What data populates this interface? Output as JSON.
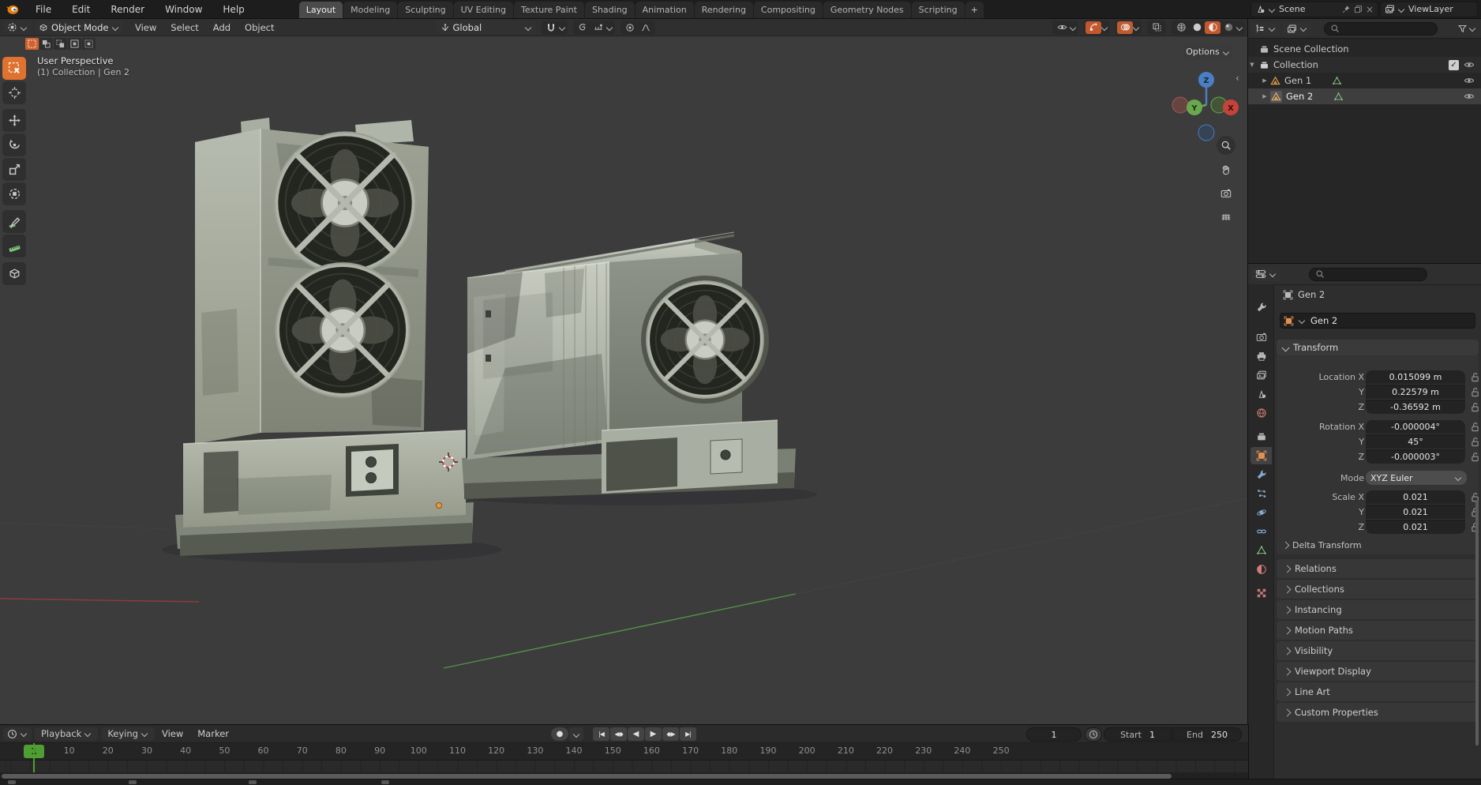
{
  "topbar": {
    "menus": [
      "File",
      "Edit",
      "Render",
      "Window",
      "Help"
    ],
    "tabs": [
      "Layout",
      "Modeling",
      "Sculpting",
      "UV Editing",
      "Texture Paint",
      "Shading",
      "Animation",
      "Rendering",
      "Compositing",
      "Geometry Nodes",
      "Scripting"
    ],
    "active_tab": "Layout",
    "new_tab_label": "+",
    "scene_label": "Scene",
    "viewlayer_label": "ViewLayer"
  },
  "viewport_header": {
    "mode": "Object Mode",
    "menus": [
      "View",
      "Select",
      "Add",
      "Object"
    ],
    "orientation": "Global",
    "options_label": "Options"
  },
  "viewport": {
    "overlay_line1": "User Perspective",
    "overlay_line2": "(1) Collection | Gen 2",
    "gizmo": {
      "x": "X",
      "y": "Y",
      "z": "Z"
    }
  },
  "outliner": {
    "rows": [
      {
        "label": "Scene Collection"
      },
      {
        "label": "Collection"
      },
      {
        "label": "Gen 1"
      },
      {
        "label": "Gen 2"
      }
    ]
  },
  "properties": {
    "breadcrumb": "Gen 2",
    "name_field": "Gen 2",
    "transform": {
      "title": "Transform",
      "location": [
        {
          "label": "Location X",
          "value": "0.015099 m"
        },
        {
          "label": "Y",
          "value": "0.22579 m"
        },
        {
          "label": "Z",
          "value": "-0.36592 m"
        }
      ],
      "rotation": [
        {
          "label": "Rotation X",
          "value": "-0.000004°"
        },
        {
          "label": "Y",
          "value": "45°"
        },
        {
          "label": "Z",
          "value": "-0.000003°"
        }
      ],
      "mode_label": "Mode",
      "mode_value": "XYZ Euler",
      "scale": [
        {
          "label": "Scale X",
          "value": "0.021"
        },
        {
          "label": "Y",
          "value": "0.021"
        },
        {
          "label": "Z",
          "value": "0.021"
        }
      ],
      "delta_label": "Delta Transform"
    },
    "collapsed_panels": [
      "Relations",
      "Collections",
      "Instancing",
      "Motion Paths",
      "Visibility",
      "Viewport Display",
      "Line Art",
      "Custom Properties"
    ]
  },
  "timeline": {
    "menus": [
      "Playback",
      "Keying",
      "View",
      "Marker"
    ],
    "current_frame": "1",
    "frame_field": "1",
    "start_label": "Start",
    "start_value": "1",
    "end_label": "End",
    "end_value": "250",
    "ruler_ticks": [
      10,
      20,
      30,
      40,
      50,
      60,
      70,
      80,
      90,
      100,
      110,
      120,
      130,
      140,
      150,
      160,
      170,
      180,
      190,
      200,
      210,
      220,
      230,
      240,
      250
    ]
  },
  "icons": {
    "search": "magnifier glyph",
    "snap": "magnet glyph",
    "filter": "funnel glyph",
    "lock": "open padlock glyph",
    "eye": "visibility eye glyph",
    "record": "●",
    "play": "▶",
    "play_reverse": "◀",
    "jump_start": "|◀",
    "jump_end": "▶|",
    "prev_keyframe": "◀◆",
    "next_keyframe": "◆▶"
  },
  "colors": {
    "accent_orange": "#e0722f",
    "toggle_orange": "#c3582f",
    "frame_green": "#4f9e33",
    "axis_red": "#a33c3c",
    "axis_green": "#56a04a",
    "tab_blue": "#84aad2",
    "data_green": "#8fcf8f",
    "material_red": "#d37c7c"
  }
}
